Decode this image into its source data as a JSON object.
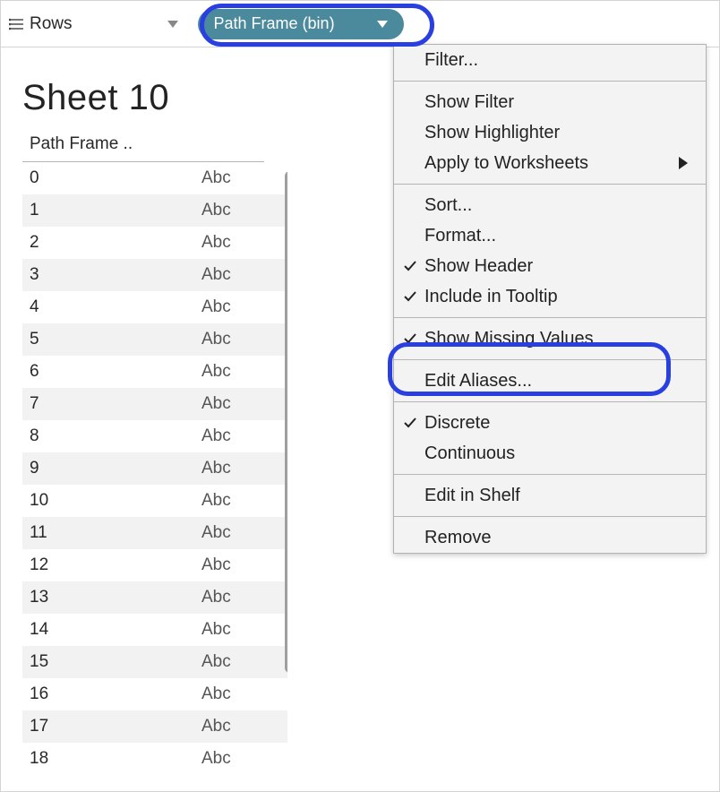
{
  "shelf": {
    "label": "Rows",
    "pill": "Path Frame (bin)"
  },
  "sheet_title": "Sheet 10",
  "table": {
    "header": "Path Frame ..",
    "value_placeholder": "Abc",
    "rows": [
      "0",
      "1",
      "2",
      "3",
      "4",
      "5",
      "6",
      "7",
      "8",
      "9",
      "10",
      "11",
      "12",
      "13",
      "14",
      "15",
      "16",
      "17",
      "18"
    ]
  },
  "menu": {
    "filter": "Filter...",
    "show_filter": "Show Filter",
    "show_highlighter": "Show Highlighter",
    "apply_ws": "Apply to Worksheets",
    "sort": "Sort...",
    "format": "Format...",
    "show_header": "Show Header",
    "include_tooltip": "Include in Tooltip",
    "show_missing": "Show Missing Values",
    "edit_aliases": "Edit Aliases...",
    "discrete": "Discrete",
    "continuous": "Continuous",
    "edit_shelf": "Edit in Shelf",
    "remove": "Remove"
  }
}
